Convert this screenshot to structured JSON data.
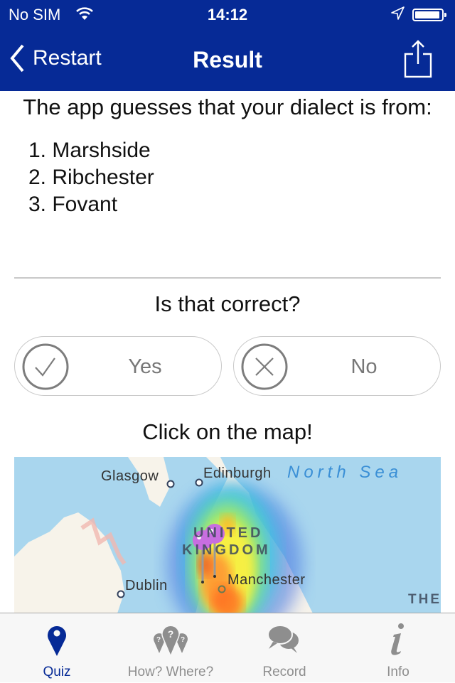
{
  "status_bar": {
    "carrier": "No SIM",
    "time": "14:12",
    "icons": [
      "wifi-icon",
      "location-arrow-icon",
      "battery-icon"
    ]
  },
  "nav": {
    "back_label": "Restart",
    "title": "Result",
    "share_icon": "share-icon"
  },
  "colors": {
    "brand": "#062a96",
    "inactive": "#8e8e8e",
    "pin": "#c86ee0"
  },
  "result": {
    "intro": "The app guesses that your dialect is from:",
    "guesses": [
      "1. Marshside",
      "2. Ribchester",
      "3. Fovant"
    ]
  },
  "feedback": {
    "question": "Is that correct?",
    "yes_label": "Yes",
    "no_label": "No"
  },
  "map": {
    "prompt": "Click on the map!",
    "labels": {
      "glasgow": "Glasgow",
      "edinburgh": "Edinburgh",
      "north_sea": "North Sea",
      "uk_line1": "UNITED",
      "uk_line2": "KINGDOM",
      "dublin": "Dublin",
      "manchester": "Manchester",
      "netherlands": "THE"
    },
    "pins": 2
  },
  "tabs": [
    {
      "label": "Quiz",
      "icon": "map-pin-icon",
      "active": true
    },
    {
      "label": "How? Where?",
      "icon": "question-pins-icon",
      "active": false
    },
    {
      "label": "Record",
      "icon": "speech-bubbles-icon",
      "active": false
    },
    {
      "label": "Info",
      "icon": "info-icon",
      "active": false
    }
  ]
}
